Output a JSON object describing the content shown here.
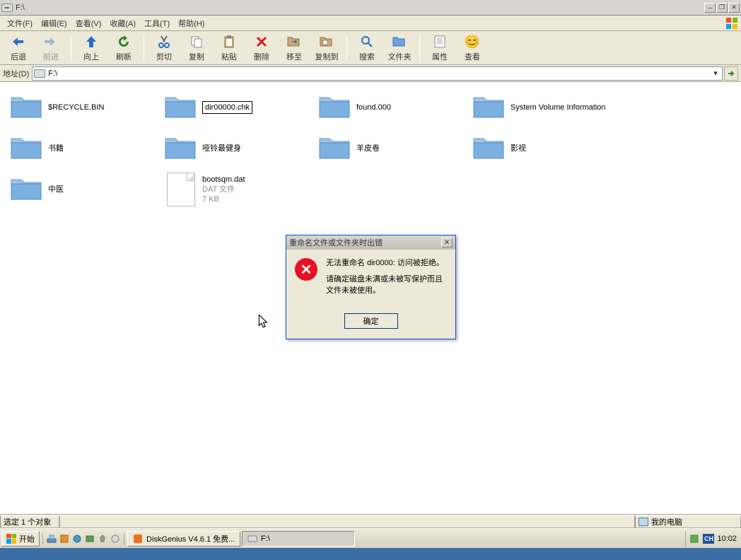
{
  "window": {
    "title": "F:\\",
    "buttons": {
      "min": "_",
      "max": "❐",
      "close": "✕"
    }
  },
  "menu": {
    "file": "文件(F)",
    "edit": "编辑(E)",
    "view": "查看(V)",
    "favorites": "收藏(A)",
    "tools": "工具(T)",
    "help": "帮助(H)"
  },
  "toolbar": {
    "back": "后退",
    "forward": "前进",
    "up": "向上",
    "refresh": "刷新",
    "cut": "剪切",
    "copy": "复制",
    "paste": "粘贴",
    "delete": "删除",
    "moveto": "移至",
    "copyto": "复制到",
    "search": "搜索",
    "folders": "文件夹",
    "properties": "属性",
    "view": "查看"
  },
  "addressbar": {
    "label": "地址(D)",
    "path": "F:\\",
    "go": "→"
  },
  "files": [
    {
      "name": "$RECYCLE.BIN",
      "type": "folder"
    },
    {
      "name": "dir00000.chk",
      "type": "folder",
      "renaming": true
    },
    {
      "name": "found.000",
      "type": "folder"
    },
    {
      "name": "System Volume Information",
      "type": "folder"
    },
    {
      "name": "书籍",
      "type": "folder"
    },
    {
      "name": "哑铃最健身",
      "type": "folder"
    },
    {
      "name": "羊皮卷",
      "type": "folder"
    },
    {
      "name": "影视",
      "type": "folder"
    },
    {
      "name": "中医",
      "type": "folder"
    },
    {
      "name": "bootsqm.dat",
      "type": "file",
      "sub1": "DAT 文件",
      "sub2": "7 KB"
    }
  ],
  "statusbar": {
    "selection": "选定 1 个对象",
    "location": "我的电脑"
  },
  "taskbar": {
    "start": "开始",
    "task1": "DiskGenius V4.6.1 免费...",
    "task2": "F:\\",
    "lang": "CH",
    "clock": "10:02"
  },
  "dialog": {
    "title": "重命名文件或文件夹时出错",
    "line1": "无法重命名 dir0000: 访问被拒绝。",
    "line2": "请确定磁盘未满或未被写保护而且文件未被使用。",
    "ok": "确定",
    "close": "✕"
  }
}
